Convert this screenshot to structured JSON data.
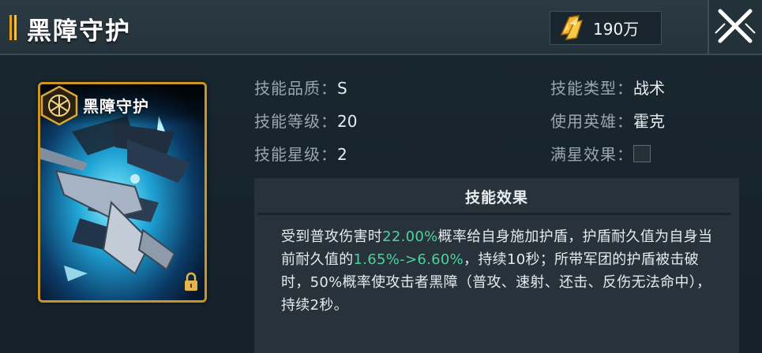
{
  "header": {
    "title": "黑障守护",
    "currency_value": "190万",
    "currency_icon": "gold-crystal-icon",
    "close_icon": "close-x-icon"
  },
  "card": {
    "title": "黑障守护",
    "badge_icon": "hexagon-skill-badge-icon",
    "corner_icon": "lock-icon"
  },
  "attributes": {
    "quality_label": "技能品质：",
    "quality_value": "S",
    "level_label": "技能等级：",
    "level_value": "20",
    "star_label": "技能星级：",
    "star_value": "2",
    "type_label": "技能类型：",
    "type_value": "战术",
    "hero_label": "使用英雄：",
    "hero_value": "霍克",
    "fullstar_label": "满星效果：",
    "fullstar_checked": false
  },
  "effect": {
    "title": "技能效果",
    "seg1": "受到普攻伤害时",
    "seg2": "22.00%",
    "seg3": "概率给自身施加护盾，护盾耐久值为自身当前耐久值的",
    "seg4": "1.65%->6.60%",
    "seg5": "，持续10秒；所带军团的护盾被击破时，50%概率使攻击者黑障（普攻、速射、还击、反伤无法命中），持续2秒。"
  },
  "colors": {
    "highlight": "#4fd19e",
    "accent_gold": "#c99624",
    "label_gray": "#9aa6ad"
  }
}
